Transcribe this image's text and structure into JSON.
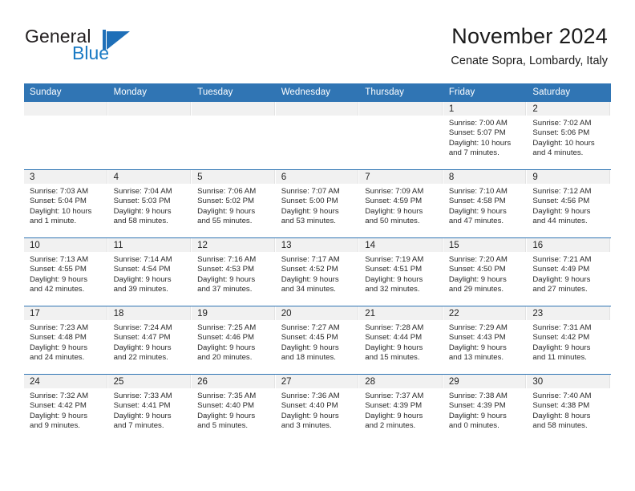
{
  "brand": {
    "name_part1": "General",
    "name_part2": "Blue",
    "mark": "triangle-flag-logo",
    "color": "#1e6fb8"
  },
  "header": {
    "title": "November 2024",
    "subtitle": "Cenate Sopra, Lombardy, Italy"
  },
  "theme": {
    "header_blue": "#3075b4",
    "date_band_gray": "#f1f1f1",
    "text": "#2a2a2a"
  },
  "weekday_headers": [
    "Sunday",
    "Monday",
    "Tuesday",
    "Wednesday",
    "Thursday",
    "Friday",
    "Saturday"
  ],
  "weeks": [
    [
      {
        "date": "",
        "sunrise": "",
        "sunset": "",
        "daylight_line1": "",
        "daylight_line2": ""
      },
      {
        "date": "",
        "sunrise": "",
        "sunset": "",
        "daylight_line1": "",
        "daylight_line2": ""
      },
      {
        "date": "",
        "sunrise": "",
        "sunset": "",
        "daylight_line1": "",
        "daylight_line2": ""
      },
      {
        "date": "",
        "sunrise": "",
        "sunset": "",
        "daylight_line1": "",
        "daylight_line2": ""
      },
      {
        "date": "",
        "sunrise": "",
        "sunset": "",
        "daylight_line1": "",
        "daylight_line2": ""
      },
      {
        "date": "1",
        "sunrise": "Sunrise: 7:00 AM",
        "sunset": "Sunset: 5:07 PM",
        "daylight_line1": "Daylight: 10 hours",
        "daylight_line2": "and 7 minutes."
      },
      {
        "date": "2",
        "sunrise": "Sunrise: 7:02 AM",
        "sunset": "Sunset: 5:06 PM",
        "daylight_line1": "Daylight: 10 hours",
        "daylight_line2": "and 4 minutes."
      }
    ],
    [
      {
        "date": "3",
        "sunrise": "Sunrise: 7:03 AM",
        "sunset": "Sunset: 5:04 PM",
        "daylight_line1": "Daylight: 10 hours",
        "daylight_line2": "and 1 minute."
      },
      {
        "date": "4",
        "sunrise": "Sunrise: 7:04 AM",
        "sunset": "Sunset: 5:03 PM",
        "daylight_line1": "Daylight: 9 hours",
        "daylight_line2": "and 58 minutes."
      },
      {
        "date": "5",
        "sunrise": "Sunrise: 7:06 AM",
        "sunset": "Sunset: 5:02 PM",
        "daylight_line1": "Daylight: 9 hours",
        "daylight_line2": "and 55 minutes."
      },
      {
        "date": "6",
        "sunrise": "Sunrise: 7:07 AM",
        "sunset": "Sunset: 5:00 PM",
        "daylight_line1": "Daylight: 9 hours",
        "daylight_line2": "and 53 minutes."
      },
      {
        "date": "7",
        "sunrise": "Sunrise: 7:09 AM",
        "sunset": "Sunset: 4:59 PM",
        "daylight_line1": "Daylight: 9 hours",
        "daylight_line2": "and 50 minutes."
      },
      {
        "date": "8",
        "sunrise": "Sunrise: 7:10 AM",
        "sunset": "Sunset: 4:58 PM",
        "daylight_line1": "Daylight: 9 hours",
        "daylight_line2": "and 47 minutes."
      },
      {
        "date": "9",
        "sunrise": "Sunrise: 7:12 AM",
        "sunset": "Sunset: 4:56 PM",
        "daylight_line1": "Daylight: 9 hours",
        "daylight_line2": "and 44 minutes."
      }
    ],
    [
      {
        "date": "10",
        "sunrise": "Sunrise: 7:13 AM",
        "sunset": "Sunset: 4:55 PM",
        "daylight_line1": "Daylight: 9 hours",
        "daylight_line2": "and 42 minutes."
      },
      {
        "date": "11",
        "sunrise": "Sunrise: 7:14 AM",
        "sunset": "Sunset: 4:54 PM",
        "daylight_line1": "Daylight: 9 hours",
        "daylight_line2": "and 39 minutes."
      },
      {
        "date": "12",
        "sunrise": "Sunrise: 7:16 AM",
        "sunset": "Sunset: 4:53 PM",
        "daylight_line1": "Daylight: 9 hours",
        "daylight_line2": "and 37 minutes."
      },
      {
        "date": "13",
        "sunrise": "Sunrise: 7:17 AM",
        "sunset": "Sunset: 4:52 PM",
        "daylight_line1": "Daylight: 9 hours",
        "daylight_line2": "and 34 minutes."
      },
      {
        "date": "14",
        "sunrise": "Sunrise: 7:19 AM",
        "sunset": "Sunset: 4:51 PM",
        "daylight_line1": "Daylight: 9 hours",
        "daylight_line2": "and 32 minutes."
      },
      {
        "date": "15",
        "sunrise": "Sunrise: 7:20 AM",
        "sunset": "Sunset: 4:50 PM",
        "daylight_line1": "Daylight: 9 hours",
        "daylight_line2": "and 29 minutes."
      },
      {
        "date": "16",
        "sunrise": "Sunrise: 7:21 AM",
        "sunset": "Sunset: 4:49 PM",
        "daylight_line1": "Daylight: 9 hours",
        "daylight_line2": "and 27 minutes."
      }
    ],
    [
      {
        "date": "17",
        "sunrise": "Sunrise: 7:23 AM",
        "sunset": "Sunset: 4:48 PM",
        "daylight_line1": "Daylight: 9 hours",
        "daylight_line2": "and 24 minutes."
      },
      {
        "date": "18",
        "sunrise": "Sunrise: 7:24 AM",
        "sunset": "Sunset: 4:47 PM",
        "daylight_line1": "Daylight: 9 hours",
        "daylight_line2": "and 22 minutes."
      },
      {
        "date": "19",
        "sunrise": "Sunrise: 7:25 AM",
        "sunset": "Sunset: 4:46 PM",
        "daylight_line1": "Daylight: 9 hours",
        "daylight_line2": "and 20 minutes."
      },
      {
        "date": "20",
        "sunrise": "Sunrise: 7:27 AM",
        "sunset": "Sunset: 4:45 PM",
        "daylight_line1": "Daylight: 9 hours",
        "daylight_line2": "and 18 minutes."
      },
      {
        "date": "21",
        "sunrise": "Sunrise: 7:28 AM",
        "sunset": "Sunset: 4:44 PM",
        "daylight_line1": "Daylight: 9 hours",
        "daylight_line2": "and 15 minutes."
      },
      {
        "date": "22",
        "sunrise": "Sunrise: 7:29 AM",
        "sunset": "Sunset: 4:43 PM",
        "daylight_line1": "Daylight: 9 hours",
        "daylight_line2": "and 13 minutes."
      },
      {
        "date": "23",
        "sunrise": "Sunrise: 7:31 AM",
        "sunset": "Sunset: 4:42 PM",
        "daylight_line1": "Daylight: 9 hours",
        "daylight_line2": "and 11 minutes."
      }
    ],
    [
      {
        "date": "24",
        "sunrise": "Sunrise: 7:32 AM",
        "sunset": "Sunset: 4:42 PM",
        "daylight_line1": "Daylight: 9 hours",
        "daylight_line2": "and 9 minutes."
      },
      {
        "date": "25",
        "sunrise": "Sunrise: 7:33 AM",
        "sunset": "Sunset: 4:41 PM",
        "daylight_line1": "Daylight: 9 hours",
        "daylight_line2": "and 7 minutes."
      },
      {
        "date": "26",
        "sunrise": "Sunrise: 7:35 AM",
        "sunset": "Sunset: 4:40 PM",
        "daylight_line1": "Daylight: 9 hours",
        "daylight_line2": "and 5 minutes."
      },
      {
        "date": "27",
        "sunrise": "Sunrise: 7:36 AM",
        "sunset": "Sunset: 4:40 PM",
        "daylight_line1": "Daylight: 9 hours",
        "daylight_line2": "and 3 minutes."
      },
      {
        "date": "28",
        "sunrise": "Sunrise: 7:37 AM",
        "sunset": "Sunset: 4:39 PM",
        "daylight_line1": "Daylight: 9 hours",
        "daylight_line2": "and 2 minutes."
      },
      {
        "date": "29",
        "sunrise": "Sunrise: 7:38 AM",
        "sunset": "Sunset: 4:39 PM",
        "daylight_line1": "Daylight: 9 hours",
        "daylight_line2": "and 0 minutes."
      },
      {
        "date": "30",
        "sunrise": "Sunrise: 7:40 AM",
        "sunset": "Sunset: 4:38 PM",
        "daylight_line1": "Daylight: 8 hours",
        "daylight_line2": "and 58 minutes."
      }
    ]
  ]
}
